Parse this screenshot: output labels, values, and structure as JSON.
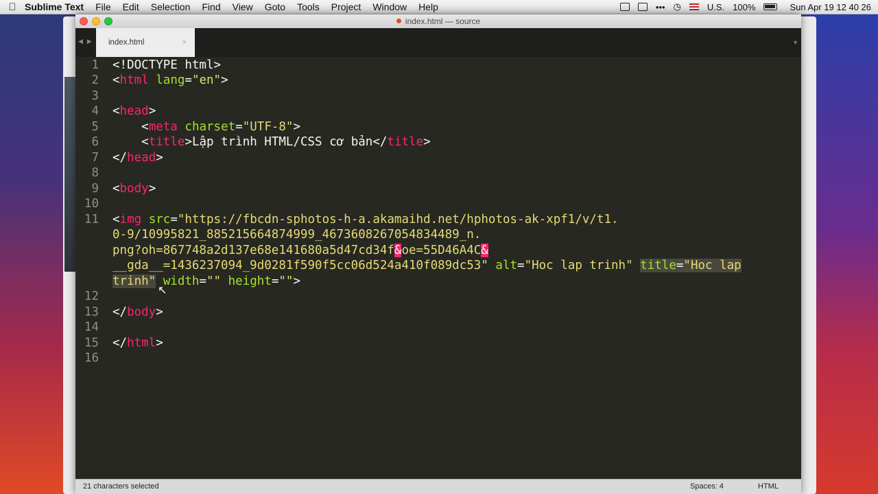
{
  "menubar": {
    "app": "Sublime Text",
    "items": [
      "File",
      "Edit",
      "Selection",
      "Find",
      "View",
      "Goto",
      "Tools",
      "Project",
      "Window",
      "Help"
    ],
    "status": {
      "input": "U.S.",
      "battery": "100%",
      "clock": "Sun Apr 19  12 40 26"
    }
  },
  "window": {
    "title": "index.html — source"
  },
  "tab": {
    "label": "index.html",
    "close": "×"
  },
  "editor": {
    "line_numbers": [
      "1",
      "2",
      "3",
      "4",
      "5",
      "6",
      "7",
      "8",
      "9",
      "10",
      "11",
      "12",
      "13",
      "14",
      "15",
      "16"
    ],
    "code": {
      "l1": "<!DOCTYPE html>",
      "l2_open": "<",
      "l2_tag": "html",
      "l2_attr": "lang",
      "l2_eq": "=",
      "l2_val": "\"en\"",
      "l2_close": ">",
      "l4_open": "<",
      "l4_tag": "head",
      "l4_close": ">",
      "l5_open": "<",
      "l5_tag": "meta",
      "l5_attr": "charset",
      "l5_eq": "=",
      "l5_val": "\"UTF-8\"",
      "l5_close": ">",
      "l6_open": "<",
      "l6_tag": "title",
      "l6_close": ">",
      "l6_text": "Lập trình HTML/CSS cơ bản",
      "l6_end_open": "</",
      "l6_end_tag": "title",
      "l6_end_close": ">",
      "l7_open": "</",
      "l7_tag": "head",
      "l7_close": ">",
      "l9_open": "<",
      "l9_tag": "body",
      "l9_close": ">",
      "l11_open": "<",
      "l11_tag": "img",
      "l11_attr": "src",
      "l11_eq": "=",
      "l11_val1": "\"https://fbcdn-sphotos-h-a.akamaihd.net/hphotos-ak-xpf1/v/t1.",
      "l11b": "0-9/10995821_885215664874999_4673608267054834489_n.",
      "l11c_a": "png?oh=867748a2d137e68e141680a5d47cd34f",
      "l11c_amp1": "&",
      "l11c_b": "oe=55D46A4C",
      "l11c_amp2": "&",
      "l11d_val": "__gda__=1436237094_9d0281f590f5cc06d524a410f089dc53\"",
      "l11d_alt": "alt",
      "l11d_eq": "=",
      "l11d_altval": "\"Hoc lap trinh\"",
      "l11d_title": "title",
      "l11d_eq2": "=",
      "l11d_titleval": "\"Hoc lap",
      "l11e_titleval": "trinh\"",
      "l11e_width": "width",
      "l11e_eq": "=",
      "l11e_wval": "\"\"",
      "l11e_height": "height",
      "l11e_eq2": "=",
      "l11e_hval": "\"\"",
      "l11e_close": ">",
      "l13_open": "</",
      "l13_tag": "body",
      "l13_close": ">",
      "l15_open": "</",
      "l15_tag": "html",
      "l15_close": ">"
    }
  },
  "statusbar": {
    "selection": "21 characters selected",
    "spaces": "Spaces: 4",
    "syntax": "HTML"
  }
}
